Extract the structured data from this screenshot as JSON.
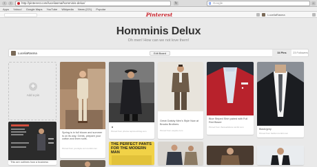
{
  "browser": {
    "url": "http://pinterest.com/luceliasma/homminis-delux/",
    "search_placeholder": "Google",
    "back_icon": "back-arrow-icon",
    "forward_icon": "forward-arrow-icon"
  },
  "bookmarks": [
    "Apps",
    "Yahoo!",
    "Google Maps",
    "YouTube",
    "Wikipedia",
    "News (221)",
    "Popular"
  ],
  "topbar": {
    "logo": "Pinterest",
    "user_name": "LuceliaRasma"
  },
  "board": {
    "title": "Homminis Delux",
    "description": "Oh men! How can we not love them!",
    "owner": "LuceliaRasma",
    "edit_label": "Edit Board",
    "pins_tab": "34 Pins",
    "followers_tab": "23 Followers"
  },
  "add_pin": {
    "label": "Add a pin"
  },
  "pins": [
    {
      "caption": "Spring is in full bloom and summer is on its way. Gents, prepare your cotton and linen suits.",
      "source": "Pinned from yourstyle.com.tumblr.com"
    },
    {
      "caption": "",
      "source": "Pinned from photos.repinned.blog.com"
    },
    {
      "caption": "Great Gatsby Men's Style Now at Brooks Brothers",
      "source": "Pinned from esquire.com"
    },
    {
      "caption": "Blue Striped Shirt paired with Full Red Blazer",
      "source": "Pinned from theswelldress.tumblr.com"
    },
    {
      "caption": "Black/grey",
      "source": "Pinned from fashion.tumblr.com"
    },
    {
      "caption": "This are outlines how a business",
      "source": ""
    },
    {
      "caption": "THE PERFECT PANTS FOR THE MODERN MAN",
      "source": ""
    }
  ],
  "colors": {
    "brand": "#c8232c",
    "background": "#e9e9e9",
    "card": "#ffffff"
  }
}
